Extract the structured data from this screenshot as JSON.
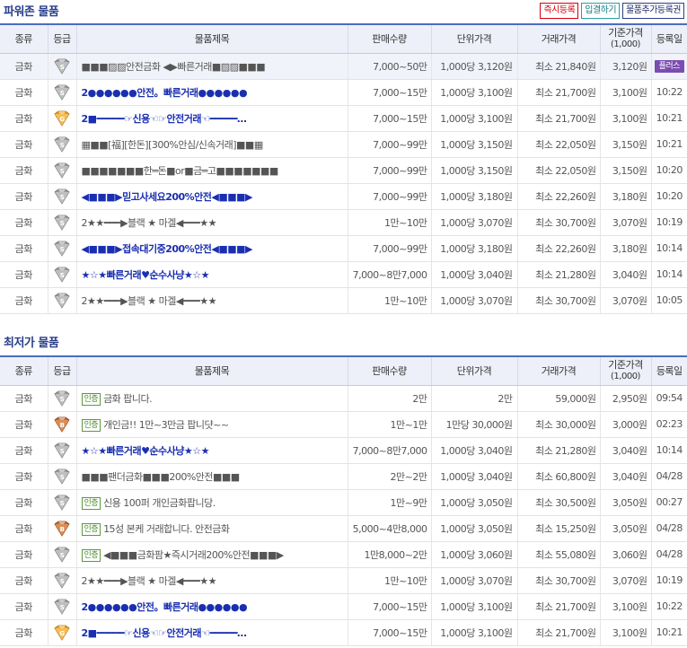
{
  "sections": {
    "power_zone_title": "파워존 물품",
    "lowest_price_title": "최저가 물품"
  },
  "top_buttons": {
    "instant": "즉시등록",
    "deposit": "입결하기",
    "add_ticket": "물품추가등록권"
  },
  "columns": {
    "type": "종류",
    "grade": "등급",
    "title": "물품제목",
    "qty": "판매수량",
    "unit": "단위가격",
    "price": "거래가격",
    "base": "기준가격",
    "base_sub": "(1,000)",
    "date": "등록일"
  },
  "colors": {
    "header_blue": "#4c6cc1",
    "price_red": "#c8281e",
    "title_blue": "#1a2fb0",
    "plus_purple": "#7a4eaf"
  },
  "power_rows": [
    {
      "type": "금화",
      "grade": "S",
      "title": "■■■▨▨안전금화 ◀▶빠른거래■▨▨■■■",
      "bold": false,
      "qty": "7,000~50만",
      "unit": "1,000당 3,120원",
      "price": "최소 21,840원",
      "base": "3,120원",
      "date": "",
      "badge": "플러스",
      "highlight": true
    },
    {
      "type": "금화",
      "grade": "S",
      "title": "2●●●●●●안전。빠른거래●●●●●●",
      "bold": false,
      "blue": true,
      "qty": "7,000~15만",
      "unit": "1,000당 3,100원",
      "price": "최소 21,700원",
      "base": "3,100원",
      "date": "10:22"
    },
    {
      "type": "금화",
      "grade": "G",
      "title": "2■━━━━━☞신용☜☞안전거래☜━━━━━…",
      "bold": false,
      "blue": true,
      "qty": "7,000~15만",
      "unit": "1,000당 3,100원",
      "price": "최소 21,700원",
      "base": "3,100원",
      "date": "10:21"
    },
    {
      "type": "금화",
      "grade": "S",
      "title": "▦■■[福][한돈][300%안심/신속거래]■■▦",
      "bold": false,
      "qty": "7,000~99만",
      "unit": "1,000당 3,150원",
      "price": "최소 22,050원",
      "base": "3,150원",
      "date": "10:21"
    },
    {
      "type": "금화",
      "grade": "S",
      "title": "■■■■■■■한═돈■or■금═고■■■■■■■",
      "bold": false,
      "qty": "7,000~99만",
      "unit": "1,000당 3,150원",
      "price": "최소 22,050원",
      "base": "3,150원",
      "date": "10:20"
    },
    {
      "type": "금화",
      "grade": "S",
      "title": "◀■■■▶믿고사세요200%안전◀■■■▶",
      "bold": true,
      "blue": true,
      "qty": "7,000~99만",
      "unit": "1,000당 3,180원",
      "price": "최소 22,260원",
      "base": "3,180원",
      "date": "10:20"
    },
    {
      "type": "금화",
      "grade": "S",
      "title": "2★★━━━▶블랙 ★ 마겔◀━━━★★",
      "bold": false,
      "qty": "1만~10만",
      "unit": "1,000당 3,070원",
      "price": "최소 30,700원",
      "base": "3,070원",
      "date": "10:19"
    },
    {
      "type": "금화",
      "grade": "S",
      "title": "◀■■■▶접속대기중200%안전◀■■■▶",
      "bold": true,
      "blue": true,
      "qty": "7,000~99만",
      "unit": "1,000당 3,180원",
      "price": "최소 22,260원",
      "base": "3,180원",
      "date": "10:14"
    },
    {
      "type": "금화",
      "grade": "S",
      "title": "★☆★빠른거래♥순수사냥★☆★",
      "bold": false,
      "blue": true,
      "qty": "7,000~8만7,000",
      "unit": "1,000당 3,040원",
      "price": "최소 21,280원",
      "base": "3,040원",
      "date": "10:14"
    },
    {
      "type": "금화",
      "grade": "S",
      "title": "2★★━━━▶블랙 ★ 마겔◀━━━★★",
      "bold": false,
      "qty": "1만~10만",
      "unit": "1,000당 3,070원",
      "price": "최소 30,700원",
      "base": "3,070원",
      "date": "10:05"
    }
  ],
  "lowest_rows": [
    {
      "type": "금화",
      "grade": "S",
      "auth": "인증",
      "title": "금화 팝니다.",
      "qty": "2만",
      "unit": "2만",
      "price": "59,000원",
      "base": "2,950원",
      "date": "09:54"
    },
    {
      "type": "금화",
      "grade": "B",
      "auth": "인증",
      "title": "개인금!! 1만~3만금 팝니댯~~",
      "qty": "1만~1만",
      "unit": "1만당 30,000원",
      "price": "최소 30,000원",
      "base": "3,000원",
      "date": "02:23"
    },
    {
      "type": "금화",
      "grade": "S",
      "title": "★☆★빠른거래♥순수사냥★☆★",
      "blue": true,
      "qty": "7,000~8만7,000",
      "unit": "1,000당 3,040원",
      "price": "최소 21,280원",
      "base": "3,040원",
      "date": "10:14"
    },
    {
      "type": "금화",
      "grade": "S",
      "title": "■■■팬더금화■■■200%안전■■■",
      "qty": "2만~2만",
      "unit": "1,000당 3,040원",
      "price": "최소 60,800원",
      "base": "3,040원",
      "date": "04/28"
    },
    {
      "type": "금화",
      "grade": "S",
      "auth": "인증",
      "title": "신용 100퍼 개인금화팝니당.",
      "qty": "1만~9만",
      "unit": "1,000당 3,050원",
      "price": "최소 30,500원",
      "base": "3,050원",
      "date": "00:27"
    },
    {
      "type": "금화",
      "grade": "B",
      "auth": "인증",
      "title": "15성 본케 거래합니다. 안전금화",
      "qty": "5,000~4만8,000",
      "unit": "1,000당 3,050원",
      "price": "최소 15,250원",
      "base": "3,050원",
      "date": "04/28"
    },
    {
      "type": "금화",
      "grade": "S",
      "auth": "인증",
      "title": "◀■■■금화팜★즉시거래200%안전■■■▶",
      "qty": "1만8,000~2만",
      "unit": "1,000당 3,060원",
      "price": "최소 55,080원",
      "base": "3,060원",
      "date": "04/28"
    },
    {
      "type": "금화",
      "grade": "S",
      "title": "2★★━━━▶블랙 ★ 마겔◀━━━★★",
      "qty": "1만~10만",
      "unit": "1,000당 3,070원",
      "price": "최소 30,700원",
      "base": "3,070원",
      "date": "10:19"
    },
    {
      "type": "금화",
      "grade": "S",
      "title": "2●●●●●●안전。빠른거래●●●●●●",
      "blue": true,
      "qty": "7,000~15만",
      "unit": "1,000당 3,100원",
      "price": "최소 21,700원",
      "base": "3,100원",
      "date": "10:22"
    },
    {
      "type": "금화",
      "grade": "G",
      "title": "2■━━━━━☞신용☜☞안전거래☜━━━━━…",
      "blue": true,
      "qty": "7,000~15만",
      "unit": "1,000당 3,100원",
      "price": "최소 21,700원",
      "base": "3,100원",
      "date": "10:21"
    }
  ]
}
